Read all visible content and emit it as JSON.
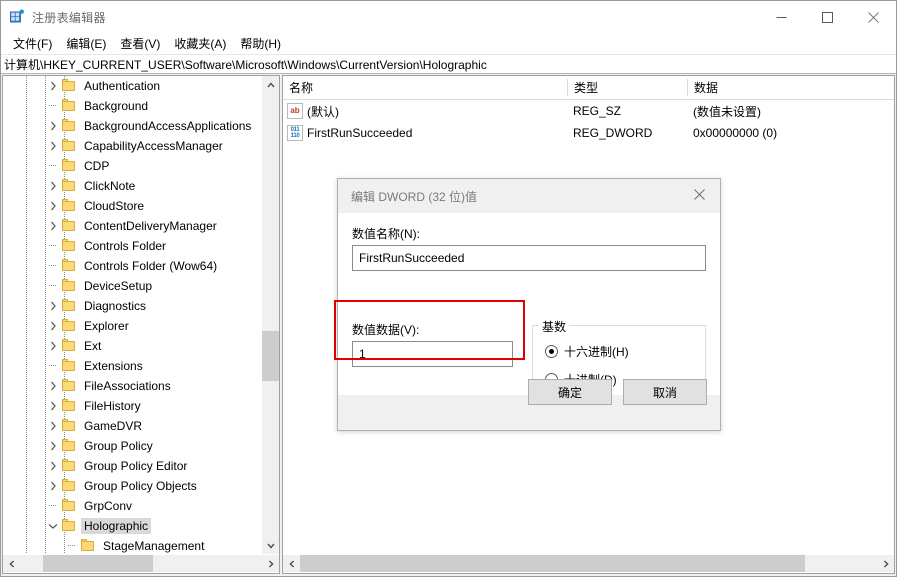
{
  "window": {
    "title": "注册表编辑器",
    "icon": "registry-editor-icon",
    "controls": {
      "minimize": "最小化",
      "maximize": "最大化",
      "close": "关闭"
    }
  },
  "menubar": {
    "items": [
      {
        "label": "文件(F)"
      },
      {
        "label": "编辑(E)"
      },
      {
        "label": "查看(V)"
      },
      {
        "label": "收藏夹(A)"
      },
      {
        "label": "帮助(H)"
      }
    ]
  },
  "address": {
    "path": "计算机\\HKEY_CURRENT_USER\\Software\\Microsoft\\Windows\\CurrentVersion\\Holographic"
  },
  "tree": {
    "nodes": [
      {
        "label": "Authentication",
        "depth": 3,
        "expander": "chevron-right",
        "selected": false
      },
      {
        "label": "Background",
        "depth": 3,
        "expander": "none",
        "selected": false
      },
      {
        "label": "BackgroundAccessApplications",
        "depth": 3,
        "expander": "chevron-right",
        "selected": false
      },
      {
        "label": "CapabilityAccessManager",
        "depth": 3,
        "expander": "chevron-right",
        "selected": false
      },
      {
        "label": "CDP",
        "depth": 3,
        "expander": "none",
        "selected": false
      },
      {
        "label": "ClickNote",
        "depth": 3,
        "expander": "chevron-right",
        "selected": false
      },
      {
        "label": "CloudStore",
        "depth": 3,
        "expander": "chevron-right",
        "selected": false
      },
      {
        "label": "ContentDeliveryManager",
        "depth": 3,
        "expander": "chevron-right",
        "selected": false
      },
      {
        "label": "Controls Folder",
        "depth": 3,
        "expander": "none",
        "selected": false
      },
      {
        "label": "Controls Folder (Wow64)",
        "depth": 3,
        "expander": "none",
        "selected": false
      },
      {
        "label": "DeviceSetup",
        "depth": 3,
        "expander": "none",
        "selected": false
      },
      {
        "label": "Diagnostics",
        "depth": 3,
        "expander": "chevron-right",
        "selected": false
      },
      {
        "label": "Explorer",
        "depth": 3,
        "expander": "chevron-right",
        "selected": false
      },
      {
        "label": "Ext",
        "depth": 3,
        "expander": "chevron-right",
        "selected": false
      },
      {
        "label": "Extensions",
        "depth": 3,
        "expander": "none",
        "selected": false
      },
      {
        "label": "FileAssociations",
        "depth": 3,
        "expander": "chevron-right",
        "selected": false
      },
      {
        "label": "FileHistory",
        "depth": 3,
        "expander": "chevron-right",
        "selected": false
      },
      {
        "label": "GameDVR",
        "depth": 3,
        "expander": "chevron-right",
        "selected": false
      },
      {
        "label": "Group Policy",
        "depth": 3,
        "expander": "chevron-right",
        "selected": false
      },
      {
        "label": "Group Policy Editor",
        "depth": 3,
        "expander": "chevron-right",
        "selected": false
      },
      {
        "label": "Group Policy Objects",
        "depth": 3,
        "expander": "chevron-right",
        "selected": false
      },
      {
        "label": "GrpConv",
        "depth": 3,
        "expander": "none",
        "selected": false
      },
      {
        "label": "Holographic",
        "depth": 3,
        "expander": "chevron-down",
        "selected": true
      },
      {
        "label": "StageManagement",
        "depth": 4,
        "expander": "none",
        "selected": false
      }
    ]
  },
  "list": {
    "columns": [
      {
        "label": "名称"
      },
      {
        "label": "类型"
      },
      {
        "label": "数据"
      }
    ],
    "rows": [
      {
        "icon": "string-value-icon",
        "icon_text": "ab",
        "name": "(默认)",
        "type": "REG_SZ",
        "data": "(数值未设置)"
      },
      {
        "icon": "dword-value-icon",
        "icon_text": "011110",
        "name": "FirstRunSucceeded",
        "type": "REG_DWORD",
        "data": "0x00000000 (0)"
      }
    ]
  },
  "dialog": {
    "title": "编辑 DWORD (32 位)值",
    "close_label": "关闭",
    "value_name_label": "数值名称(N):",
    "value_name": "FirstRunSucceeded",
    "value_data_label": "数值数据(V):",
    "value_data": "1",
    "base_group_label": "基数",
    "radio_hex": "十六进制(H)",
    "radio_dec": "十进制(D)",
    "selected_base": "十六进制(H)",
    "ok_label": "确定",
    "cancel_label": "取消"
  },
  "annotation": {
    "highlight_color": "#e00000",
    "target": "数值数据(V) 输入框"
  }
}
